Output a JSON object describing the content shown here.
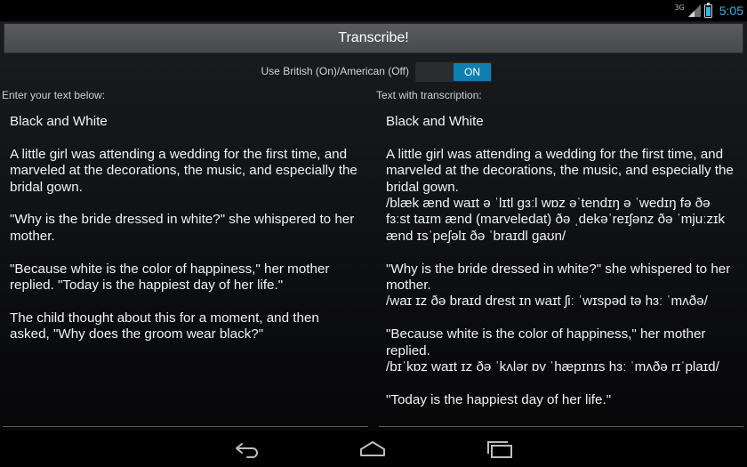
{
  "status_bar": {
    "network": "3G",
    "time": "5:05"
  },
  "toolbar": {
    "transcribe_label": "Transcribe!"
  },
  "toggle": {
    "label": "Use British (On)/American (Off)",
    "state": "ON"
  },
  "input_panel": {
    "label": "Enter your text below:",
    "paragraphs": [
      "Black and White",
      "A little girl was attending a wedding for the first time, and marveled at the decorations, the music, and especially the bridal gown.",
      "\"Why is the bride dressed in white?\" she whispered to her mother.",
      "\"Because white is the color of happiness,\" her mother replied. \"Today is the happiest day of her life.\"",
      "The child thought about this for a moment, and then asked, \"Why does the groom wear black?\""
    ]
  },
  "output_panel": {
    "label": "Text with transcription:",
    "paragraphs": [
      "Black and White",
      "A little girl was attending a wedding for the first time, and marveled at the decorations, the music, and especially the bridal gown.\n/blæk ænd waɪt ə ˈlɪtl gɜːl wɒz əˈtendɪŋ ə ˈwedɪŋ fə ðə fɜːst taɪm ænd (marveledat) ðə ˌdekəˈreɪʃənz ðə ˈmjuːzɪk ænd ɪsˈpeʃəlɪ ðə ˈbraɪdl gaʊn/",
      "\"Why is the bride dressed in white?\" she whispered to her mother.\n/waɪ ɪz ðə braɪd drest ɪn waɪt ʃiː ˈwɪspəd tə hɜː ˈmʌðə/",
      "\"Because white is the color of happiness,\" her mother replied.\n/bɪˈkɒz waɪt ɪz ðə ˈkʌlər ɒv ˈhæpɪnɪs hɜː ˈmʌðə rɪˈplaɪd/",
      "\"Today is the happiest day of her life.\""
    ]
  },
  "nav_bar": {
    "icons": [
      "back-icon",
      "home-icon",
      "recents-icon"
    ]
  },
  "colors": {
    "accent": "#33b5e5",
    "toggle_on": "#0f7fb0",
    "button": "#4f5255"
  }
}
